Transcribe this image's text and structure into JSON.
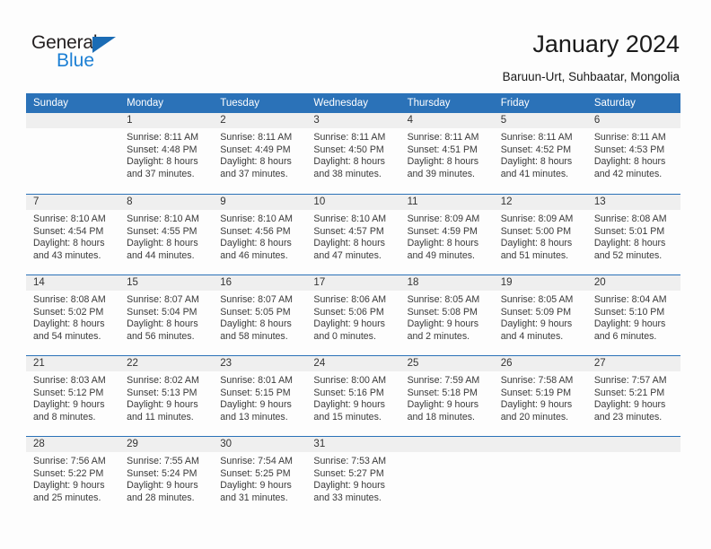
{
  "brand": {
    "name_dark": "General",
    "name_light": "Blue",
    "accent_color": "#1b6cb5",
    "header_color": "#2b72b8"
  },
  "header": {
    "title": "January 2024",
    "subtitle": "Baruun-Urt, Suhbaatar, Mongolia"
  },
  "calendar": {
    "weekdays": [
      "Sunday",
      "Monday",
      "Tuesday",
      "Wednesday",
      "Thursday",
      "Friday",
      "Saturday"
    ],
    "weeks": [
      [
        {
          "day": "",
          "lines": [
            "",
            "",
            "",
            ""
          ]
        },
        {
          "day": "1",
          "lines": [
            "Sunrise: 8:11 AM",
            "Sunset: 4:48 PM",
            "Daylight: 8 hours",
            "and 37 minutes."
          ]
        },
        {
          "day": "2",
          "lines": [
            "Sunrise: 8:11 AM",
            "Sunset: 4:49 PM",
            "Daylight: 8 hours",
            "and 37 minutes."
          ]
        },
        {
          "day": "3",
          "lines": [
            "Sunrise: 8:11 AM",
            "Sunset: 4:50 PM",
            "Daylight: 8 hours",
            "and 38 minutes."
          ]
        },
        {
          "day": "4",
          "lines": [
            "Sunrise: 8:11 AM",
            "Sunset: 4:51 PM",
            "Daylight: 8 hours",
            "and 39 minutes."
          ]
        },
        {
          "day": "5",
          "lines": [
            "Sunrise: 8:11 AM",
            "Sunset: 4:52 PM",
            "Daylight: 8 hours",
            "and 41 minutes."
          ]
        },
        {
          "day": "6",
          "lines": [
            "Sunrise: 8:11 AM",
            "Sunset: 4:53 PM",
            "Daylight: 8 hours",
            "and 42 minutes."
          ]
        }
      ],
      [
        {
          "day": "7",
          "lines": [
            "Sunrise: 8:10 AM",
            "Sunset: 4:54 PM",
            "Daylight: 8 hours",
            "and 43 minutes."
          ]
        },
        {
          "day": "8",
          "lines": [
            "Sunrise: 8:10 AM",
            "Sunset: 4:55 PM",
            "Daylight: 8 hours",
            "and 44 minutes."
          ]
        },
        {
          "day": "9",
          "lines": [
            "Sunrise: 8:10 AM",
            "Sunset: 4:56 PM",
            "Daylight: 8 hours",
            "and 46 minutes."
          ]
        },
        {
          "day": "10",
          "lines": [
            "Sunrise: 8:10 AM",
            "Sunset: 4:57 PM",
            "Daylight: 8 hours",
            "and 47 minutes."
          ]
        },
        {
          "day": "11",
          "lines": [
            "Sunrise: 8:09 AM",
            "Sunset: 4:59 PM",
            "Daylight: 8 hours",
            "and 49 minutes."
          ]
        },
        {
          "day": "12",
          "lines": [
            "Sunrise: 8:09 AM",
            "Sunset: 5:00 PM",
            "Daylight: 8 hours",
            "and 51 minutes."
          ]
        },
        {
          "day": "13",
          "lines": [
            "Sunrise: 8:08 AM",
            "Sunset: 5:01 PM",
            "Daylight: 8 hours",
            "and 52 minutes."
          ]
        }
      ],
      [
        {
          "day": "14",
          "lines": [
            "Sunrise: 8:08 AM",
            "Sunset: 5:02 PM",
            "Daylight: 8 hours",
            "and 54 minutes."
          ]
        },
        {
          "day": "15",
          "lines": [
            "Sunrise: 8:07 AM",
            "Sunset: 5:04 PM",
            "Daylight: 8 hours",
            "and 56 minutes."
          ]
        },
        {
          "day": "16",
          "lines": [
            "Sunrise: 8:07 AM",
            "Sunset: 5:05 PM",
            "Daylight: 8 hours",
            "and 58 minutes."
          ]
        },
        {
          "day": "17",
          "lines": [
            "Sunrise: 8:06 AM",
            "Sunset: 5:06 PM",
            "Daylight: 9 hours",
            "and 0 minutes."
          ]
        },
        {
          "day": "18",
          "lines": [
            "Sunrise: 8:05 AM",
            "Sunset: 5:08 PM",
            "Daylight: 9 hours",
            "and 2 minutes."
          ]
        },
        {
          "day": "19",
          "lines": [
            "Sunrise: 8:05 AM",
            "Sunset: 5:09 PM",
            "Daylight: 9 hours",
            "and 4 minutes."
          ]
        },
        {
          "day": "20",
          "lines": [
            "Sunrise: 8:04 AM",
            "Sunset: 5:10 PM",
            "Daylight: 9 hours",
            "and 6 minutes."
          ]
        }
      ],
      [
        {
          "day": "21",
          "lines": [
            "Sunrise: 8:03 AM",
            "Sunset: 5:12 PM",
            "Daylight: 9 hours",
            "and 8 minutes."
          ]
        },
        {
          "day": "22",
          "lines": [
            "Sunrise: 8:02 AM",
            "Sunset: 5:13 PM",
            "Daylight: 9 hours",
            "and 11 minutes."
          ]
        },
        {
          "day": "23",
          "lines": [
            "Sunrise: 8:01 AM",
            "Sunset: 5:15 PM",
            "Daylight: 9 hours",
            "and 13 minutes."
          ]
        },
        {
          "day": "24",
          "lines": [
            "Sunrise: 8:00 AM",
            "Sunset: 5:16 PM",
            "Daylight: 9 hours",
            "and 15 minutes."
          ]
        },
        {
          "day": "25",
          "lines": [
            "Sunrise: 7:59 AM",
            "Sunset: 5:18 PM",
            "Daylight: 9 hours",
            "and 18 minutes."
          ]
        },
        {
          "day": "26",
          "lines": [
            "Sunrise: 7:58 AM",
            "Sunset: 5:19 PM",
            "Daylight: 9 hours",
            "and 20 minutes."
          ]
        },
        {
          "day": "27",
          "lines": [
            "Sunrise: 7:57 AM",
            "Sunset: 5:21 PM",
            "Daylight: 9 hours",
            "and 23 minutes."
          ]
        }
      ],
      [
        {
          "day": "28",
          "lines": [
            "Sunrise: 7:56 AM",
            "Sunset: 5:22 PM",
            "Daylight: 9 hours",
            "and 25 minutes."
          ]
        },
        {
          "day": "29",
          "lines": [
            "Sunrise: 7:55 AM",
            "Sunset: 5:24 PM",
            "Daylight: 9 hours",
            "and 28 minutes."
          ]
        },
        {
          "day": "30",
          "lines": [
            "Sunrise: 7:54 AM",
            "Sunset: 5:25 PM",
            "Daylight: 9 hours",
            "and 31 minutes."
          ]
        },
        {
          "day": "31",
          "lines": [
            "Sunrise: 7:53 AM",
            "Sunset: 5:27 PM",
            "Daylight: 9 hours",
            "and 33 minutes."
          ]
        },
        {
          "day": "",
          "lines": [
            "",
            "",
            "",
            ""
          ]
        },
        {
          "day": "",
          "lines": [
            "",
            "",
            "",
            ""
          ]
        },
        {
          "day": "",
          "lines": [
            "",
            "",
            "",
            ""
          ]
        }
      ]
    ]
  }
}
